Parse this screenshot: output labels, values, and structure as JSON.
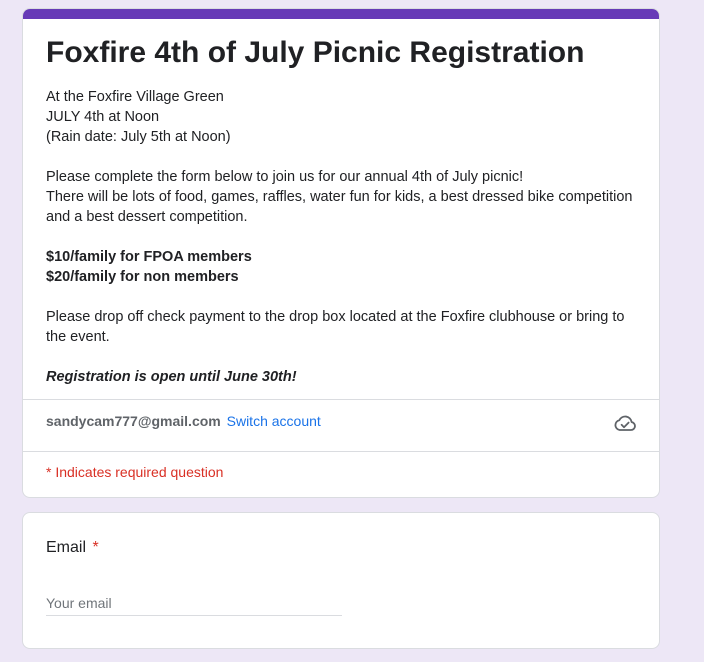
{
  "form": {
    "title": "Foxfire 4th of July Picnic Registration",
    "description": {
      "line1": "At the Foxfire Village Green",
      "line2": "JULY 4th at Noon",
      "line3": "(Rain date:  July 5th at Noon)",
      "line4": "Please complete the form below to join us for our annual 4th of July picnic!",
      "line5": "There will be lots of food, games, raffles, water fun for kids, a best dressed bike competition and a best dessert competition.",
      "price_members": "$10/family for FPOA members",
      "price_nonmembers": "$20/family for non members",
      "payment": "Please drop off check payment to the drop box located at the Foxfire clubhouse or bring to the event.",
      "deadline": "Registration is open until June 30th!"
    },
    "account": {
      "email": "sandycam777@gmail.com",
      "switch_label": "Switch account",
      "icon": "cloud-check-icon"
    },
    "required_note": "* Indicates required question"
  },
  "questions": {
    "email": {
      "label": "Email",
      "required_marker": "*",
      "placeholder": "Your email",
      "value": ""
    }
  },
  "colors": {
    "accent": "#673ab7",
    "background": "#ede7f6",
    "link": "#1a73e8",
    "required": "#d93025"
  }
}
